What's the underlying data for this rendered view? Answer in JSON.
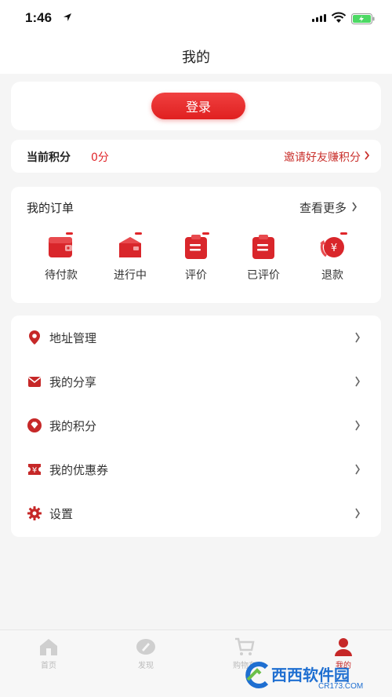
{
  "status_bar": {
    "time": "1:46"
  },
  "nav": {
    "title": "我的"
  },
  "login": {
    "button_label": "登录"
  },
  "points": {
    "label": "当前积分",
    "value": "0分",
    "invite_label": "邀请好友赚积分"
  },
  "orders": {
    "title": "我的订单",
    "more_label": "查看更多",
    "items": [
      {
        "label": "待付款",
        "icon": "wallet-icon"
      },
      {
        "label": "进行中",
        "icon": "package-icon"
      },
      {
        "label": "评价",
        "icon": "clipboard-icon"
      },
      {
        "label": "已评价",
        "icon": "clipboard-done-icon"
      },
      {
        "label": "退款",
        "icon": "refund-icon"
      }
    ]
  },
  "menu": {
    "items": [
      {
        "label": "地址管理",
        "icon": "location-pin-icon"
      },
      {
        "label": "我的分享",
        "icon": "envelope-icon"
      },
      {
        "label": "我的积分",
        "icon": "diamond-icon"
      },
      {
        "label": "我的优惠券",
        "icon": "coupon-icon"
      },
      {
        "label": "设置",
        "icon": "gear-icon"
      }
    ]
  },
  "tabs": [
    {
      "label": "首页",
      "icon": "home-icon"
    },
    {
      "label": "发现",
      "icon": "compass-icon"
    },
    {
      "label": "购物车",
      "icon": "cart-icon"
    },
    {
      "label": "我的",
      "icon": "user-icon",
      "active": true
    }
  ],
  "watermark": {
    "text": "西西软件园",
    "sub": "CR173.COM"
  },
  "colors": {
    "accent": "#e0262a",
    "link": "#c9302c",
    "background": "#f5f5f5"
  }
}
